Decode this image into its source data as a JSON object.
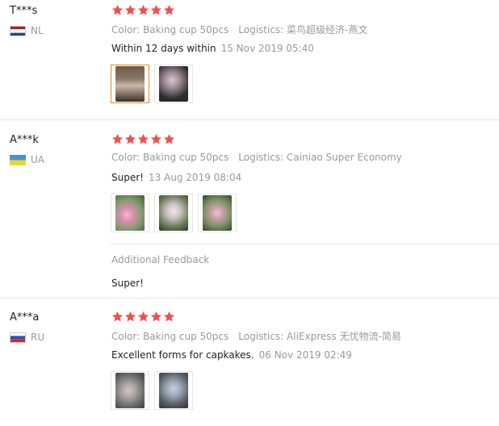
{
  "reviews": [
    {
      "user": "T***s",
      "country": "NL",
      "rating": 5,
      "color_label": "Color: Baking cup 50pcs",
      "logistics_label": "Logistics: 菜鸟超级经济-燕文",
      "text": "Within 12 days within",
      "date": "15 Nov 2019 05:40",
      "photo_count": 2
    },
    {
      "user": "A***k",
      "country": "UA",
      "rating": 5,
      "color_label": "Color: Baking cup 50pcs",
      "logistics_label": "Logistics: Cainiao Super Economy",
      "text": "Super!",
      "date": "13 Aug 2019 08:04",
      "photo_count": 3,
      "additional_feedback": {
        "label": "Additional Feedback",
        "text": "Super!"
      }
    },
    {
      "user": "A***a",
      "country": "RU",
      "rating": 5,
      "color_label": "Color: Baking cup 50pcs",
      "logistics_label": "Logistics: AliExpress 无忧物流-简易",
      "text": "Excellent forms for capkakes.",
      "date": "06 Nov 2019 02:49",
      "photo_count": 2
    }
  ],
  "colors": {
    "star": "#f44d4d",
    "selected_thumb_border": "#e8891c",
    "muted_text": "#999999",
    "divider": "#e8e8e8"
  },
  "icons": {
    "star": "star-icon",
    "flag_nl": "flag-nl-icon",
    "flag_ua": "flag-ua-icon",
    "flag_ru": "flag-ru-icon"
  }
}
